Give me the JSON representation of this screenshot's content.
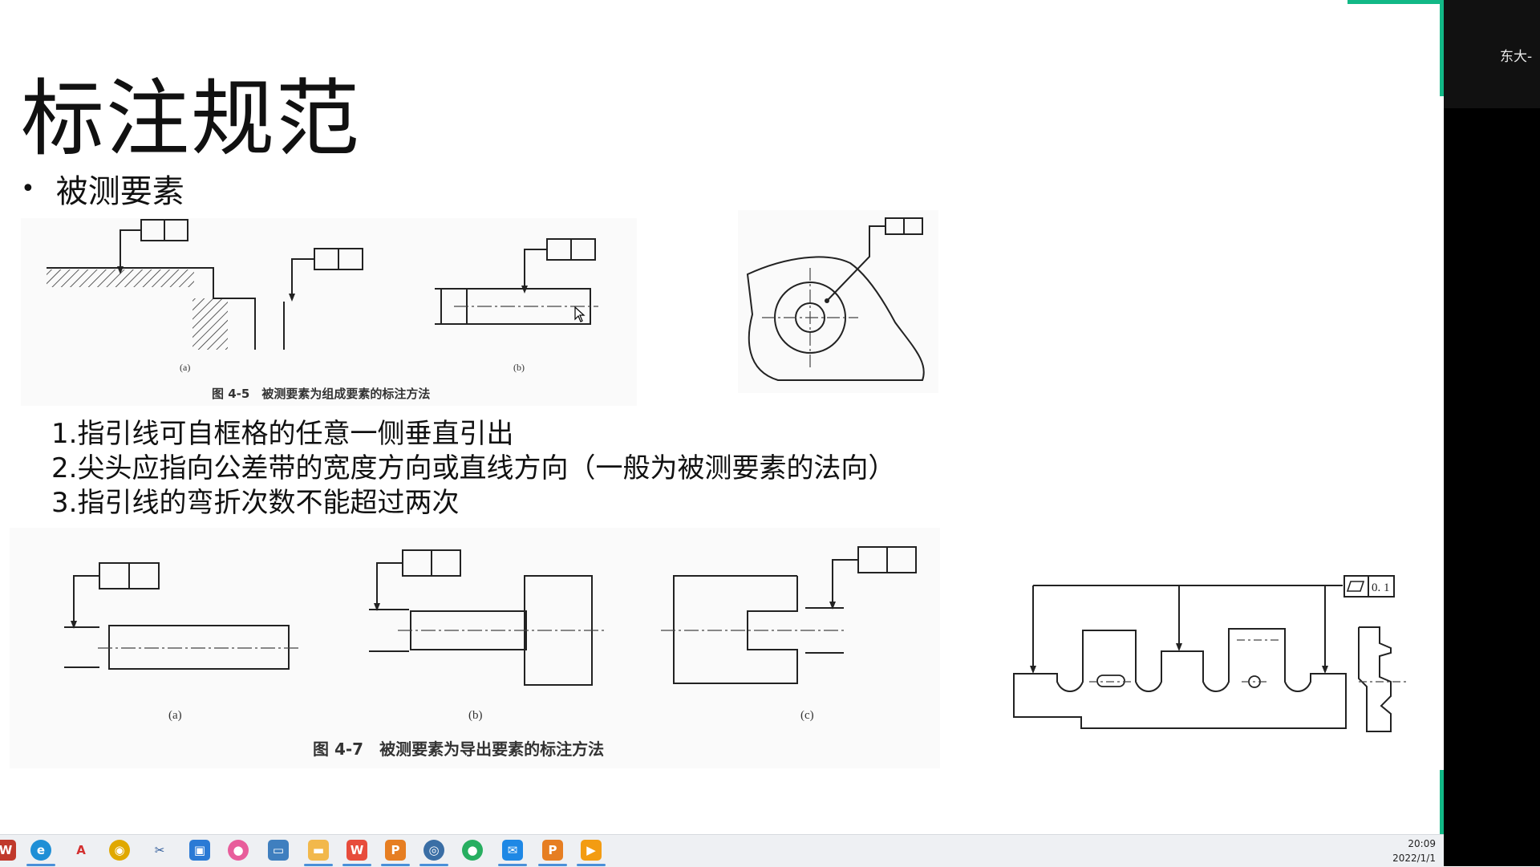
{
  "slide": {
    "title": "标注规范",
    "bullet": "被测要素",
    "points": [
      "1.指引线可自框格的任意一侧垂直引出",
      "2.尖头应指向公差带的宽度方向或直线方向（一般为被测要素的法向）",
      "3.指引线的弯折次数不能超过两次"
    ],
    "figure1": {
      "caption": "图 4-5　被测要素为组成要素的标注方法",
      "label_a": "(a)",
      "label_b": "(b)"
    },
    "figure2": {
      "caption": "图 4-7　被测要素为导出要素的标注方法",
      "label_a": "(a)",
      "label_b": "(b)",
      "label_c": "(c)"
    },
    "figure4": {
      "tolerance": "0. 1"
    }
  },
  "meeting": {
    "label": "东大-"
  },
  "taskbar": {
    "icons": [
      "wps-icon",
      "edge-icon",
      "acrobat-icon",
      "chrome-icon",
      "snipping-icon",
      "store-icon",
      "photos-icon",
      "window-icon",
      "folder-icon",
      "wps-writer-icon",
      "wps-ppt-icon",
      "tencent-meeting-icon",
      "wechat-icon",
      "mail-icon",
      "office-icon",
      "media-player-icon"
    ],
    "time": "20:09",
    "date": "2022/1/1"
  },
  "colors": {
    "accent": "#12b886",
    "taskbar": "#eef0f3"
  }
}
